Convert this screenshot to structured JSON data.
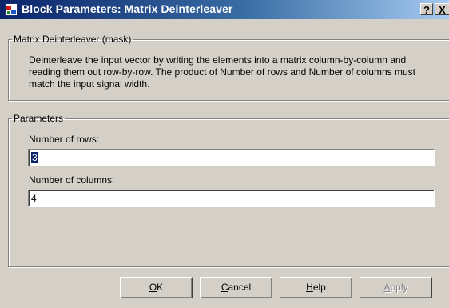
{
  "window": {
    "title": "Block Parameters: Matrix Deinterleaver",
    "help_glyph": "?",
    "close_glyph": "X",
    "icon": "simulink-block-icon"
  },
  "mask_group": {
    "legend": "Matrix Deinterleaver (mask)",
    "description": "Deinterleave the input vector by writing the elements into a matrix column-by-column and reading them out row-by-row.  The product of Number of rows and Number of columns must match the input signal width."
  },
  "parameters": {
    "legend": "Parameters",
    "rows": {
      "label": "Number of rows:",
      "value": "3"
    },
    "columns": {
      "label": "Number of columns:",
      "value": "4"
    }
  },
  "buttons": {
    "ok": {
      "mnemonic": "O",
      "rest": "K"
    },
    "cancel": {
      "mnemonic": "C",
      "rest": "ancel"
    },
    "help": {
      "mnemonic": "H",
      "rest": "elp"
    },
    "apply": {
      "mnemonic": "A",
      "rest": "pply",
      "enabled": false
    }
  }
}
